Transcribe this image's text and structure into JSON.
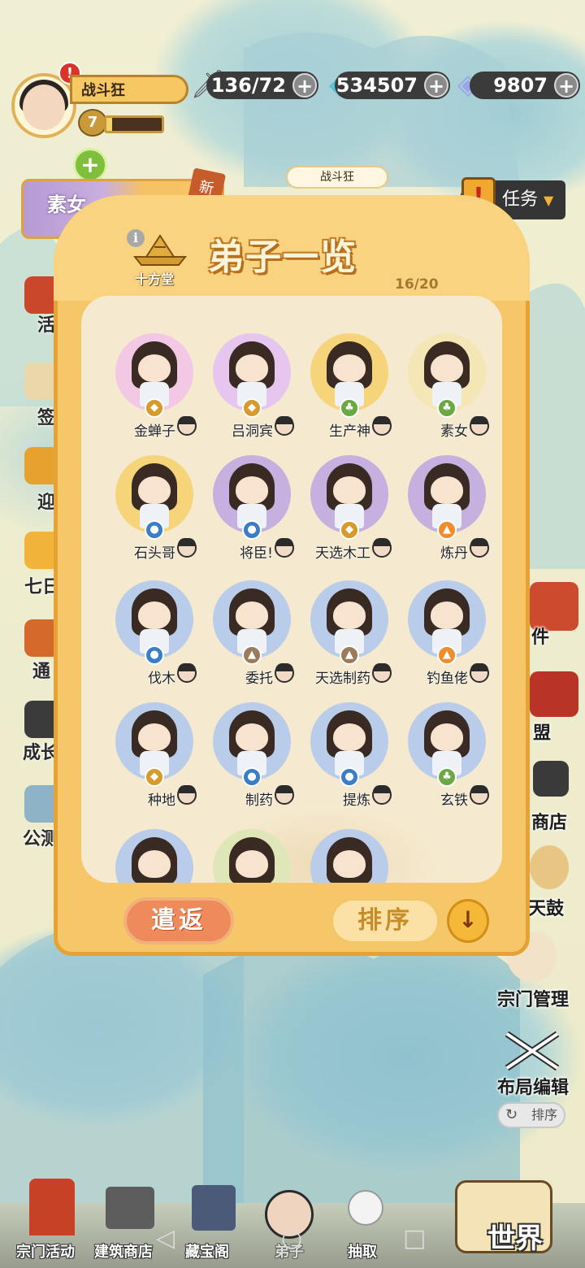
{
  "player": {
    "name": "战斗狂",
    "level": "7",
    "alert": "!"
  },
  "resources": [
    {
      "name": "stamina",
      "icon": "sword-icon",
      "value": "136/72",
      "plus": "+"
    },
    {
      "name": "spirit-stone",
      "icon": "crystal-icon",
      "value": "534507",
      "plus": "+"
    },
    {
      "name": "gem",
      "icon": "diamond-icon",
      "value": "9807",
      "plus": "+"
    }
  ],
  "left_panel": {
    "add": "+",
    "featured_name": "素女",
    "new_tag": "新",
    "chat_name": "战斗狂"
  },
  "tasks": {
    "label": "任务",
    "excl": "!"
  },
  "panel": {
    "title": "弟子一览",
    "count": "16/20",
    "info": "i",
    "hall_label": "十方堂"
  },
  "disciples": [
    {
      "name": "金蝉子",
      "element": "earth",
      "elem_color": "#d79a2c",
      "bg": "#f2c8e4"
    },
    {
      "name": "吕洞宾",
      "element": "earth",
      "elem_color": "#d79a2c",
      "bg": "#e6c6ef"
    },
    {
      "name": "生产神",
      "element": "wood",
      "elem_color": "#6aa843",
      "bg": "#f6d57a"
    },
    {
      "name": "素女",
      "element": "wood",
      "elem_color": "#6aa843",
      "bg": "#f4e6b5"
    },
    {
      "name": "石头哥",
      "element": "water",
      "elem_color": "#3a7ec7",
      "bg": "#f6d57a"
    },
    {
      "name": "将臣!",
      "element": "water",
      "elem_color": "#3a7ec7",
      "bg": "#c5b0e0"
    },
    {
      "name": "天选木工",
      "element": "earth",
      "elem_color": "#d79a2c",
      "bg": "#c5b0e0"
    },
    {
      "name": "炼丹",
      "element": "fire",
      "elem_color": "#ef8d2a",
      "bg": "#c5b0e0"
    },
    {
      "name": "伐木",
      "element": "water",
      "elem_color": "#3a7ec7",
      "bg": "#b9cdea"
    },
    {
      "name": "委托",
      "element": "mountain",
      "elem_color": "#9a7c5c",
      "bg": "#b9cdea"
    },
    {
      "name": "天选制药",
      "element": "mountain",
      "elem_color": "#9a7c5c",
      "bg": "#b9cdea"
    },
    {
      "name": "钓鱼佬",
      "element": "fire",
      "elem_color": "#ef8d2a",
      "bg": "#b9cdea"
    },
    {
      "name": "种地",
      "element": "earth",
      "elem_color": "#d79a2c",
      "bg": "#b9cdea"
    },
    {
      "name": "制药",
      "element": "water",
      "elem_color": "#3a7ec7",
      "bg": "#b9cdea"
    },
    {
      "name": "提炼",
      "element": "water",
      "elem_color": "#3a7ec7",
      "bg": "#b9cdea"
    },
    {
      "name": "玄铁",
      "element": "wood",
      "elem_color": "#6aa843",
      "bg": "#b9cdea"
    }
  ],
  "partial_row_bgs": [
    "#b9cdea",
    "#dfe7b8",
    "#b9cdea"
  ],
  "buttons": {
    "return": "遣返",
    "sort": "排序",
    "sort_dir": "↓"
  },
  "left_side": [
    {
      "label": "活",
      "name": "activity"
    },
    {
      "label": "签",
      "name": "sign"
    },
    {
      "label": "迎",
      "name": "welcome"
    },
    {
      "label": "七日",
      "name": "seven-day"
    },
    {
      "label": "通",
      "name": "pass"
    },
    {
      "label": "成长",
      "name": "growth"
    },
    {
      "label": "公测",
      "name": "public-test"
    }
  ],
  "right_side": [
    {
      "label": "件",
      "name": "mail"
    },
    {
      "label": "盟",
      "name": "alliance"
    },
    {
      "label": "商店",
      "name": "shop"
    },
    {
      "label": "天鼓",
      "name": "drum"
    },
    {
      "label": "宗门管理",
      "name": "sect-management"
    },
    {
      "label": "布局编辑",
      "name": "layout-edit"
    },
    {
      "label": "排序",
      "name": "reorder"
    }
  ],
  "bottom_nav": [
    {
      "label": "宗门活动",
      "name": "sect-activity"
    },
    {
      "label": "建筑商店",
      "name": "building-shop"
    },
    {
      "label": "藏宝阁",
      "name": "treasure-pavilion"
    },
    {
      "label": "弟子",
      "name": "disciples"
    },
    {
      "label": "抽取",
      "name": "draw"
    }
  ],
  "world": "世界"
}
